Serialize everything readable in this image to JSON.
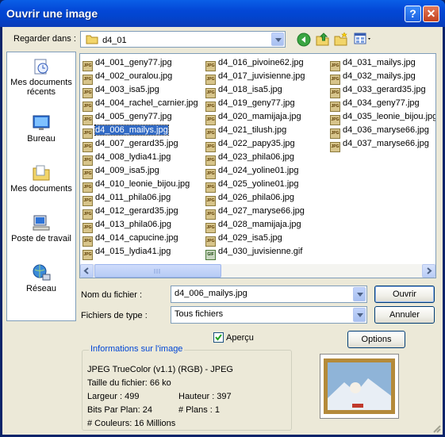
{
  "window": {
    "title": "Ouvrir une image",
    "help_label": "?",
    "close_label": "✕"
  },
  "lookin": {
    "label": "Regarder dans :",
    "value": "d4_01"
  },
  "toolbar_icons": [
    "back-arrow-icon",
    "up-folder-icon",
    "new-folder-icon",
    "view-menu-icon"
  ],
  "places": [
    {
      "label": "Mes documents récents",
      "icon": "recent-documents-icon"
    },
    {
      "label": "Bureau",
      "icon": "desktop-icon"
    },
    {
      "label": "Mes documents",
      "icon": "my-documents-icon"
    },
    {
      "label": "Poste de travail",
      "icon": "my-computer-icon"
    },
    {
      "label": "Réseau",
      "icon": "network-icon"
    }
  ],
  "files": {
    "col1": [
      "d4_001_geny77.jpg",
      "d4_002_ouralou.jpg",
      "d4_003_isa5.jpg",
      "d4_004_rachel_carnier.jpg",
      "d4_005_geny77.jpg",
      "d4_006_mailys.jpg",
      "d4_007_gerard35.jpg",
      "d4_008_lydia41.jpg",
      "d4_009_isa5.jpg",
      "d4_010_leonie_bijou.jpg",
      "d4_011_phila06.jpg",
      "d4_012_gerard35.jpg",
      "d4_013_phila06.jpg",
      "d4_014_capucine.jpg",
      "d4_015_lydia41.jpg"
    ],
    "col2": [
      "d4_016_pivoine62.jpg",
      "d4_017_juvisienne.jpg",
      "d4_018_isa5.jpg",
      "d4_019_geny77.jpg",
      "d4_020_mamijaja.jpg",
      "d4_021_tilush.jpg",
      "d4_022_papy35.jpg",
      "d4_023_phila06.jpg",
      "d4_024_yoline01.jpg",
      "d4_025_yoline01.jpg",
      "d4_026_phila06.jpg",
      "d4_027_maryse66.jpg",
      "d4_028_mamijaja.jpg",
      "d4_029_isa5.jpg",
      "d4_030_juvisienne.gif"
    ],
    "col3": [
      "d4_031_mailys.jpg",
      "d4_032_mailys.jpg",
      "d4_033_gerard35.jpg",
      "d4_034_geny77.jpg",
      "d4_035_leonie_bijou.jpg",
      "d4_036_maryse66.jpg",
      "d4_037_maryse66.jpg"
    ],
    "selected": "d4_006_mailys.jpg",
    "jpg_badge": "JPG",
    "gif_badge": "GIF"
  },
  "filename": {
    "label": "Nom du fichier :",
    "value": "d4_006_mailys.jpg"
  },
  "filetype": {
    "label": "Fichiers de type :",
    "value": "Tous fichiers"
  },
  "buttons": {
    "open": "Ouvrir",
    "cancel": "Annuler",
    "options": "Options"
  },
  "preview": {
    "label": "Aperçu",
    "checked": true
  },
  "info": {
    "legend": "Informations sur l'image",
    "format": "JPEG TrueColor (v1.1) (RGB) - JPEG",
    "size": "Taille du fichier: 66 ko",
    "width": "Largeur : 499",
    "height": "Hauteur : 397",
    "bits": "Bits Par Plan: 24",
    "planes": "# Plans : 1",
    "colors": "# Couleurs: 16 Millions"
  },
  "colors": {
    "titlebar": "#0347d6",
    "selection": "#316ac5",
    "dialog_bg": "#ece9d8"
  }
}
